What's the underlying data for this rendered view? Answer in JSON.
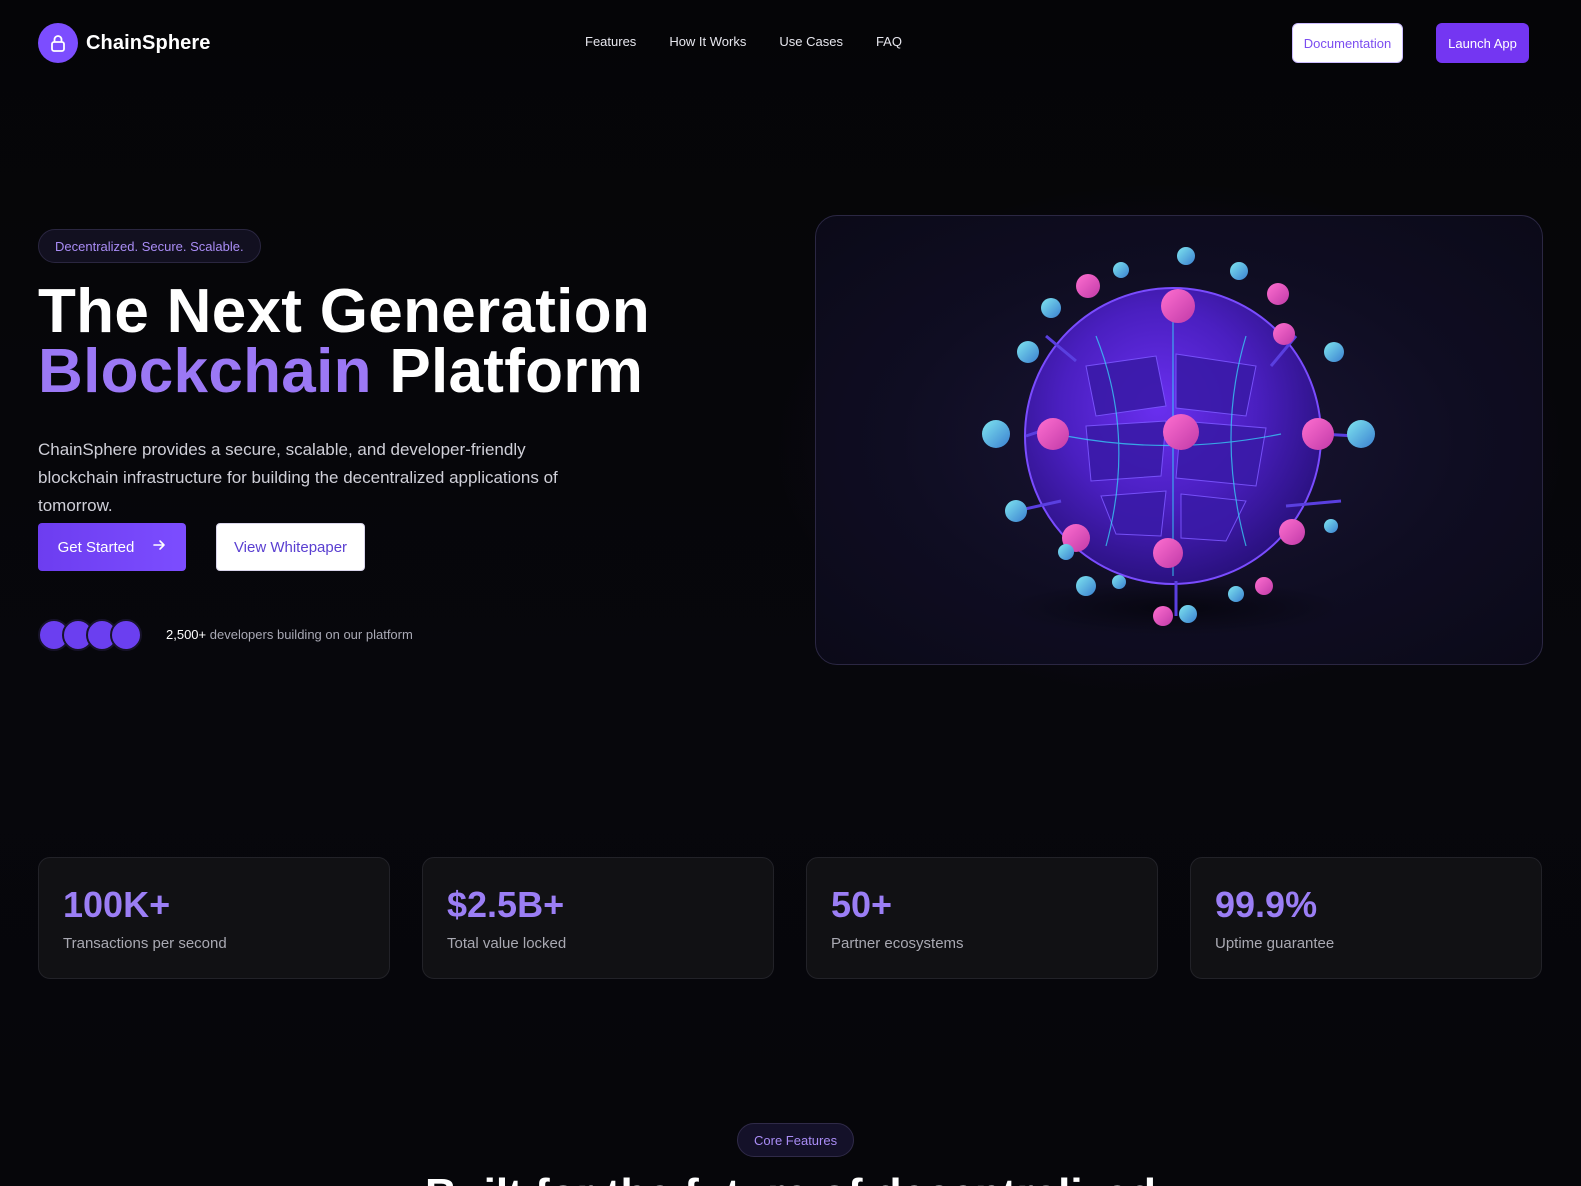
{
  "brand": {
    "name": "ChainSphere",
    "logo_icon": "lock-icon",
    "accent": "#7c4dff"
  },
  "nav": {
    "links": [
      "Features",
      "How It Works",
      "Use Cases",
      "FAQ"
    ],
    "documentation_label": "Documentation",
    "launch_label": "Launch App"
  },
  "hero": {
    "badge": "Decentralized. Secure. Scalable.",
    "title_line1": "The Next Generation",
    "title_accent": "Blockchain",
    "title_rest": "Platform",
    "description": "ChainSphere provides a secure, scalable, and developer-friendly blockchain infrastructure for building the decentralized applications of tomorrow.",
    "get_started_label": "Get Started",
    "whitepaper_label": "View Whitepaper",
    "dev_count": "2,500+",
    "dev_text": "developers building on our platform"
  },
  "stats": [
    {
      "value": "100K+",
      "label": "Transactions per second"
    },
    {
      "value": "$2.5B+",
      "label": "Total value locked"
    },
    {
      "value": "50+",
      "label": "Partner ecosystems"
    },
    {
      "value": "99.9%",
      "label": "Uptime guarantee"
    }
  ],
  "features": {
    "badge": "Core Features",
    "title": "Built for the future of decentralized"
  },
  "colors": {
    "background": "#050507",
    "accent_text": "#9b78f5",
    "primary_button": "#7436f2"
  }
}
